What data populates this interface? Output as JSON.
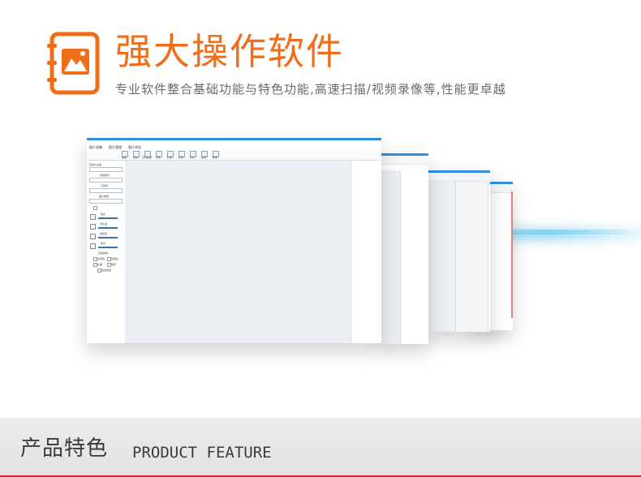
{
  "header": {
    "title": "强大操作软件",
    "subtitle": "专业软件整合基础功能与特色功能,高速扫描/视频录像等,性能更卓越"
  },
  "footer": {
    "title_cn": "产品特色",
    "title_en": "PRODUCT FEATURE"
  },
  "colors": {
    "accent": "#f06d1a",
    "window_border": "#2f8fde",
    "footer_line": "#cc2a26"
  },
  "app_window": {
    "menu": [
      "图片采集",
      "图片管理",
      "图片浏览"
    ],
    "toolbar": [
      "拍照",
      "连拍",
      "定时拍摄",
      "录像",
      "扫描",
      "条码",
      "合并",
      "设置",
      "帮助"
    ],
    "sidebar_labels": [
      "高拍仪设备",
      "视频格式",
      "分辨率",
      "图片类型",
      "色彩",
      "对比度",
      "饱和度",
      "曝光",
      "自动裁剪"
    ],
    "options": [
      "去底色",
      "去黑边",
      "纠偏",
      "旋转",
      "自动连拍"
    ]
  }
}
